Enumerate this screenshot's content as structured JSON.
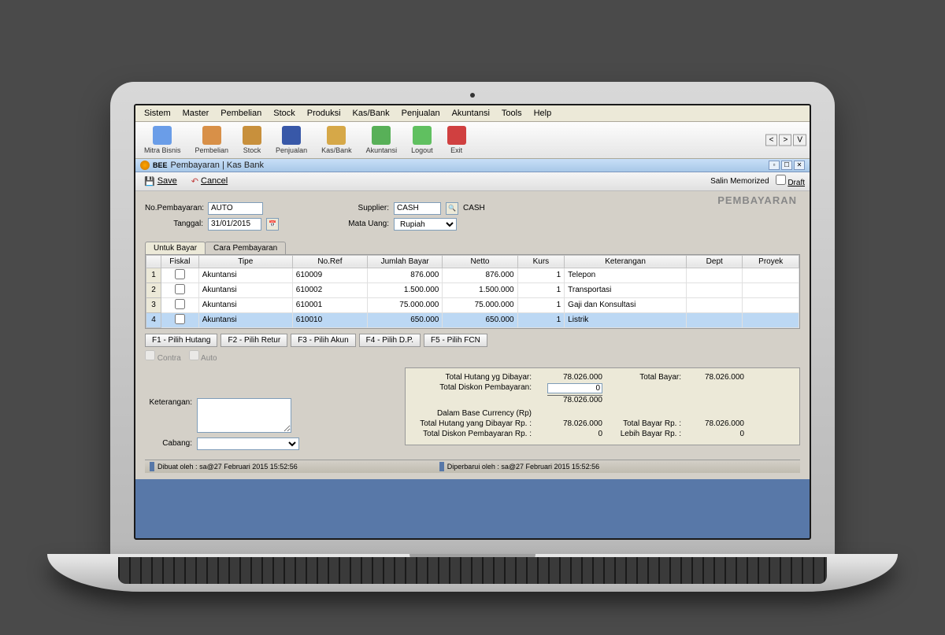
{
  "menubar": [
    "Sistem",
    "Master",
    "Pembelian",
    "Stock",
    "Produksi",
    "Kas/Bank",
    "Penjualan",
    "Akuntansi",
    "Tools",
    "Help"
  ],
  "toolbar": [
    {
      "label": "Mitra Bisnis",
      "color": "#6a9de8"
    },
    {
      "label": "Pembelian",
      "color": "#d89048"
    },
    {
      "label": "Stock",
      "color": "#c8903c"
    },
    {
      "label": "Penjualan",
      "color": "#3858a8"
    },
    {
      "label": "Kas/Bank",
      "color": "#d6a848"
    },
    {
      "label": "Akuntansi",
      "color": "#58b058"
    },
    {
      "label": "Logout",
      "color": "#60c060"
    },
    {
      "label": "Exit",
      "color": "#d04040"
    }
  ],
  "toolbar_right": [
    "<",
    ">",
    "V"
  ],
  "window": {
    "logo_text": "BEE",
    "title": "Pembayaran | Kas Bank"
  },
  "actions": {
    "save": "Save",
    "cancel": "Cancel",
    "memorized": "Salin Memorized",
    "draft": "Draft"
  },
  "page_title": "PEMBAYARAN",
  "header": {
    "no_label": "No.Pembayaran:",
    "no_value": "AUTO",
    "tanggal_label": "Tanggal:",
    "tanggal_value": "31/01/2015",
    "supplier_label": "Supplier:",
    "supplier_value": "CASH",
    "supplier_name": "CASH",
    "currency_label": "Mata Uang:",
    "currency_value": "Rupiah"
  },
  "tabs": [
    "Untuk Bayar",
    "Cara Pembayaran"
  ],
  "grid": {
    "columns": [
      "",
      "Fiskal",
      "Tipe",
      "No.Ref",
      "Jumlah Bayar",
      "Netto",
      "Kurs",
      "Keterangan",
      "Dept",
      "Proyek"
    ],
    "rows": [
      {
        "n": "1",
        "tipe": "Akuntansi",
        "ref": "610009",
        "bayar": "876.000",
        "netto": "876.000",
        "kurs": "1",
        "ket": "Telepon"
      },
      {
        "n": "2",
        "tipe": "Akuntansi",
        "ref": "610002",
        "bayar": "1.500.000",
        "netto": "1.500.000",
        "kurs": "1",
        "ket": "Transportasi"
      },
      {
        "n": "3",
        "tipe": "Akuntansi",
        "ref": "610001",
        "bayar": "75.000.000",
        "netto": "75.000.000",
        "kurs": "1",
        "ket": "Gaji dan Konsultasi"
      },
      {
        "n": "4",
        "tipe": "Akuntansi",
        "ref": "610010",
        "bayar": "650.000",
        "netto": "650.000",
        "kurs": "1",
        "ket": "Listrik"
      }
    ]
  },
  "func_buttons": [
    "F1 - Pilih Hutang",
    "F2 - Pilih Retur",
    "F3 - Pilih Akun",
    "F4 - Pilih D.P.",
    "F5 - Pilih FCN"
  ],
  "checks": [
    "Contra",
    "Auto"
  ],
  "totals": {
    "hutang_label": "Total Hutang yg Dibayar:",
    "hutang_val": "78.026.000",
    "bayar_label": "Total Bayar:",
    "bayar_val": "78.026.000",
    "diskon_label": "Total Diskon Pembayaran:",
    "diskon_val": "0",
    "subtotal": "78.026.000",
    "base_header": "Dalam Base Currency (Rp)",
    "hutang_rp_label": "Total Hutang yang Dibayar Rp. :",
    "hutang_rp_val": "78.026.000",
    "bayar_rp_label": "Total Bayar Rp. :",
    "bayar_rp_val": "78.026.000",
    "diskon_rp_label": "Total Diskon Pembayaran Rp. :",
    "diskon_rp_val": "0",
    "lebih_label": "Lebih Bayar Rp. :",
    "lebih_val": "0"
  },
  "bottom": {
    "ket_label": "Keterangan:",
    "cabang_label": "Cabang:"
  },
  "status": {
    "created_label": "Dibuat oleh :",
    "created_val": "sa@27 Februari 2015  15:52:56",
    "updated_label": "Diperbarui oleh :",
    "updated_val": "sa@27 Februari 2015  15:52:56"
  }
}
